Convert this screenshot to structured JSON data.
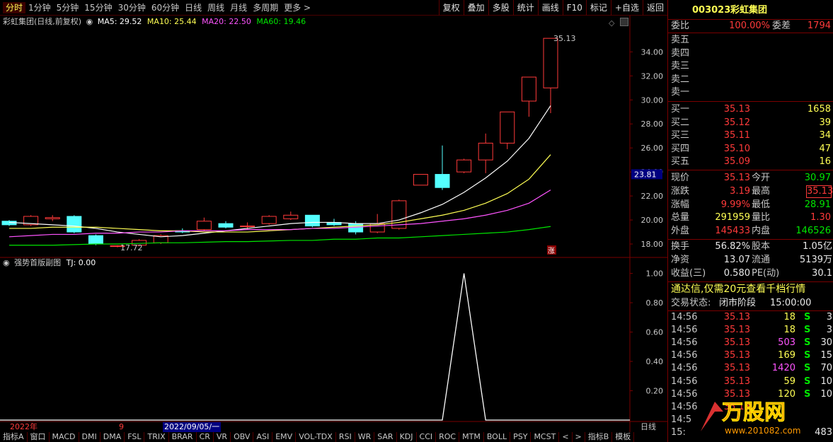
{
  "topbar": {
    "periods": [
      "分时",
      "1分钟",
      "5分钟",
      "15分钟",
      "30分钟",
      "60分钟",
      "日线",
      "周线",
      "月线",
      "多周期",
      "更多 >"
    ],
    "active_period": "分时",
    "buttons": [
      "复权",
      "叠加",
      "多股",
      "统计",
      "画线",
      "F10",
      "标记",
      "+自选",
      "返回"
    ]
  },
  "infobar": {
    "title": "彩虹集团(日线,前复权)",
    "ma5": "MA5: 29.52",
    "ma10": "MA10: 25.44",
    "ma20": "MA20: 22.50",
    "ma60": "MA60: 19.46"
  },
  "subinfo": {
    "title": "强势首版副图",
    "tj": "TJ: 0.00"
  },
  "colors": {
    "up": "#ff3a3a",
    "down": "#54ffff",
    "ma5": "#ffffff",
    "ma10": "#ffff54",
    "ma20": "#ff54ff",
    "ma60": "#00e600"
  },
  "chart_data": [
    {
      "type": "candlestick",
      "ylim": [
        17,
        36.2
      ],
      "yticks": [
        "34.00",
        "32.00",
        "30.00",
        "28.00",
        "26.00",
        "24.00",
        "22.00",
        "20.00",
        "18.00"
      ],
      "current_price_label": "23.81",
      "high_label": "35.13",
      "low_label": "17.72",
      "limit_mark": "涨",
      "candles": [
        {
          "o": 19.9,
          "h": 20.0,
          "l": 19.5,
          "c": 19.6
        },
        {
          "o": 19.6,
          "h": 20.4,
          "l": 19.5,
          "c": 20.3
        },
        {
          "o": 20.1,
          "h": 20.4,
          "l": 19.9,
          "c": 20.2
        },
        {
          "o": 20.3,
          "h": 20.4,
          "l": 18.9,
          "c": 19.0
        },
        {
          "o": 18.7,
          "h": 18.8,
          "l": 17.9,
          "c": 18.0
        },
        {
          "o": 17.8,
          "h": 17.9,
          "l": 17.72,
          "c": 17.85
        },
        {
          "o": 17.9,
          "h": 18.4,
          "l": 17.8,
          "c": 18.3
        },
        {
          "o": 18.1,
          "h": 18.8,
          "l": 18.0,
          "c": 18.7
        },
        {
          "o": 19.1,
          "h": 19.3,
          "l": 18.9,
          "c": 19.0
        },
        {
          "o": 19.2,
          "h": 20.2,
          "l": 19.1,
          "c": 19.9
        },
        {
          "o": 19.7,
          "h": 19.9,
          "l": 19.3,
          "c": 19.4
        },
        {
          "o": 19.5,
          "h": 19.8,
          "l": 19.2,
          "c": 19.5
        },
        {
          "o": 19.7,
          "h": 20.4,
          "l": 19.6,
          "c": 20.3
        },
        {
          "o": 20.1,
          "h": 20.7,
          "l": 20.0,
          "c": 20.4
        },
        {
          "o": 20.4,
          "h": 20.4,
          "l": 19.4,
          "c": 19.5
        },
        {
          "o": 19.8,
          "h": 20.1,
          "l": 19.5,
          "c": 19.6
        },
        {
          "o": 19.7,
          "h": 19.9,
          "l": 18.8,
          "c": 19.0
        },
        {
          "o": 19.0,
          "h": 20.5,
          "l": 18.9,
          "c": 19.7
        },
        {
          "o": 19.3,
          "h": 21.7,
          "l": 19.2,
          "c": 21.6
        },
        {
          "o": 22.9,
          "h": 23.8,
          "l": 22.9,
          "c": 23.8
        },
        {
          "o": 23.8,
          "h": 26.2,
          "l": 22.5,
          "c": 22.7
        },
        {
          "o": 24.0,
          "h": 25.1,
          "l": 23.9,
          "c": 25.0
        },
        {
          "o": 25.0,
          "h": 27.2,
          "l": 23.9,
          "c": 26.4
        },
        {
          "o": 26.4,
          "h": 28.8,
          "l": 25.9,
          "c": 29.0
        },
        {
          "o": 29.9,
          "h": 31.9,
          "l": 28.6,
          "c": 31.9
        },
        {
          "o": 31.0,
          "h": 35.13,
          "l": 28.9,
          "c": 35.13
        }
      ],
      "series": [
        {
          "name": "MA5",
          "values": [
            19.8,
            19.7,
            19.6,
            19.5,
            19.3,
            19.0,
            18.8,
            18.6,
            18.7,
            18.9,
            19.1,
            19.3,
            19.5,
            19.7,
            19.8,
            19.8,
            19.7,
            19.7,
            20.0,
            20.6,
            21.3,
            22.3,
            23.5,
            24.9,
            26.8,
            29.52
          ]
        },
        {
          "name": "MA10",
          "values": [
            19.3,
            19.3,
            19.4,
            19.4,
            19.4,
            19.3,
            19.2,
            19.1,
            19.1,
            19.0,
            19.0,
            19.0,
            19.1,
            19.2,
            19.3,
            19.4,
            19.5,
            19.6,
            19.8,
            20.1,
            20.4,
            20.8,
            21.4,
            22.2,
            23.4,
            25.44
          ]
        },
        {
          "name": "MA20",
          "values": [
            18.6,
            18.7,
            18.8,
            18.8,
            18.9,
            18.9,
            19.0,
            19.0,
            19.1,
            19.1,
            19.1,
            19.2,
            19.2,
            19.2,
            19.3,
            19.3,
            19.4,
            19.5,
            19.6,
            19.7,
            19.9,
            20.1,
            20.4,
            20.8,
            21.4,
            22.5
          ]
        },
        {
          "name": "MA60",
          "values": [
            17.9,
            17.9,
            17.9,
            17.95,
            18.0,
            18.0,
            18.05,
            18.1,
            18.1,
            18.15,
            18.2,
            18.2,
            18.25,
            18.3,
            18.3,
            18.4,
            18.4,
            18.5,
            18.5,
            18.6,
            18.7,
            18.8,
            18.9,
            19.0,
            19.2,
            19.46
          ]
        }
      ]
    },
    {
      "type": "line",
      "ylim": [
        0,
        1.08
      ],
      "yticks": [
        "1.00",
        "0.80",
        "0.60",
        "0.40",
        "0.20"
      ],
      "values": [
        0,
        0,
        0,
        0,
        0,
        0,
        0,
        0,
        0,
        0,
        0,
        0,
        0,
        0,
        0,
        0,
        0,
        0,
        0,
        0,
        0,
        1,
        0,
        0,
        0,
        0
      ]
    }
  ],
  "datebar": {
    "year": "2022年",
    "month": "9",
    "cursor_date": "2022/09/05/一",
    "period": "日线"
  },
  "indicator_tabs": [
    "指标A",
    "窗口",
    "MACD",
    "DMI",
    "DMA",
    "FSL",
    "TRIX",
    "BRAR",
    "CR",
    "VR",
    "OBV",
    "ASI",
    "EMV",
    "VOL-TDX",
    "RSI",
    "WR",
    "SAR",
    "KDJ",
    "CCI",
    "ROC",
    "MTM",
    "BOLL",
    "PSY",
    "MCST",
    "<",
    ">",
    "指标B",
    "模板"
  ],
  "panel": {
    "code": "003023",
    "name": "彩虹集团",
    "weibi_label": "委比",
    "weibi_value": "100.00%",
    "weicha_label": "委差",
    "weicha_value": "1794",
    "sells": [
      "卖五",
      "卖四",
      "卖三",
      "卖二",
      "卖一"
    ],
    "buys": [
      {
        "label": "买一",
        "price": "35.13",
        "vol": "1658"
      },
      {
        "label": "买二",
        "price": "35.12",
        "vol": "39"
      },
      {
        "label": "买三",
        "price": "35.11",
        "vol": "34"
      },
      {
        "label": "买四",
        "price": "35.10",
        "vol": "47"
      },
      {
        "label": "买五",
        "price": "35.09",
        "vol": "16"
      }
    ],
    "stats": [
      {
        "l1": "现价",
        "v1": "35.13",
        "l2": "今开",
        "v2": "30.97"
      },
      {
        "l1": "涨跌",
        "v1": "3.19",
        "l2": "最高",
        "v2": "35.13"
      },
      {
        "l1": "涨幅",
        "v1": "9.99%",
        "l2": "最低",
        "v2": "28.91"
      },
      {
        "l1": "总量",
        "v1": "291959",
        "l2": "量比",
        "v2": "1.30"
      },
      {
        "l1": "外盘",
        "v1": "145433",
        "l2": "内盘",
        "v2": "146526"
      }
    ],
    "stats2": [
      {
        "l1": "换手",
        "v1": "56.82%",
        "l2": "股本",
        "v2": "1.05亿"
      },
      {
        "l1": "净资",
        "v1": "13.07",
        "l2": "流通",
        "v2": "5139万"
      },
      {
        "l1": "收益(三)",
        "v1": "0.580",
        "l2": "PE(动)",
        "v2": "30.1"
      }
    ],
    "ad_text": "通达信,仅需20元查看千档行情",
    "status_label": "交易状态:",
    "status_value": "闭市阶段",
    "status_time": "15:00:00",
    "ticks": [
      {
        "t": "14:56",
        "p": "35.13",
        "v": "18",
        "s": "S",
        "n": "3"
      },
      {
        "t": "14:56",
        "p": "35.13",
        "v": "18",
        "s": "S",
        "n": "3"
      },
      {
        "t": "14:56",
        "p": "35.13",
        "v": "503",
        "s": "S",
        "n": "30"
      },
      {
        "t": "14:56",
        "p": "35.13",
        "v": "169",
        "s": "S",
        "n": "15"
      },
      {
        "t": "14:56",
        "p": "35.13",
        "v": "1420",
        "s": "S",
        "n": "70"
      },
      {
        "t": "14:56",
        "p": "35.13",
        "v": "59",
        "s": "S",
        "n": "10"
      },
      {
        "t": "14:56",
        "p": "35.13",
        "v": "120",
        "s": "S",
        "n": "10"
      },
      {
        "t": "14:56",
        "p": "35.13",
        "v": "",
        "s": "",
        "n": ""
      },
      {
        "t": "14:5",
        "p": "",
        "v": "",
        "s": "",
        "n": ""
      },
      {
        "t": "15:",
        "p": "",
        "v": "",
        "s": "",
        "n": "483"
      }
    ],
    "watermark": "万股网",
    "watermark_url": "www.201082.com"
  }
}
